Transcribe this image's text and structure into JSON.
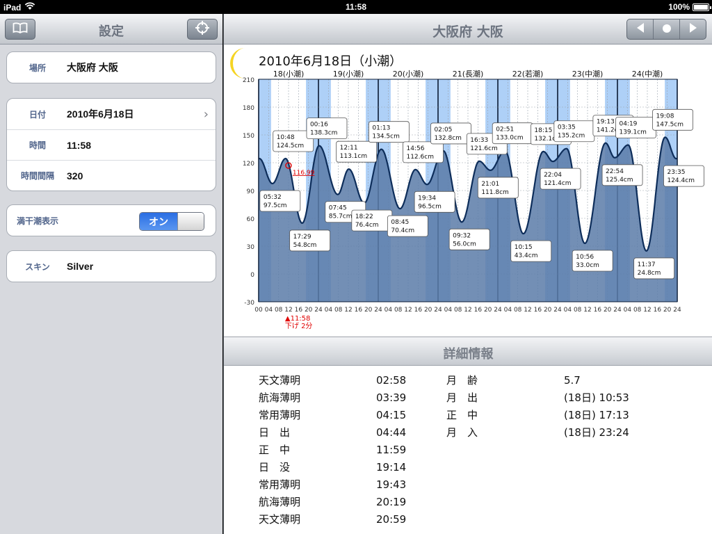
{
  "status": {
    "device": "iPad",
    "time": "11:58",
    "battery": "100%",
    "battery_level": 1.0
  },
  "left": {
    "title": "設定",
    "groups": {
      "place": {
        "label": "場所",
        "value": "大阪府 大阪"
      },
      "date": {
        "label": "日付",
        "value": "2010年6月18日"
      },
      "time": {
        "label": "時間",
        "value": "11:58"
      },
      "interval": {
        "label": "時間間隔",
        "value": "320"
      },
      "tidal": {
        "label": "満干潮表示",
        "toggle": "オン",
        "toggle_on": true
      },
      "skin": {
        "label": "スキン",
        "value": "Silver"
      }
    }
  },
  "right": {
    "title": "大阪府 大阪",
    "detail_title": "詳細情報"
  },
  "colors": {
    "line": "#0d2d5a",
    "fill": "#5a7ba8",
    "day_band": "#aed0f7",
    "night_band": "#ffffff",
    "current": "#e00000"
  },
  "chart_data": {
    "type": "area",
    "title": "2010年6月18日（小潮）",
    "ylim": [
      -30,
      210
    ],
    "yticks": [
      210,
      180,
      150,
      120,
      90,
      60,
      30,
      0,
      -30
    ],
    "days": [
      "18(小潮)",
      "19(小潮)",
      "20(小潮)",
      "21(長潮)",
      "22(若潮)",
      "23(中潮)",
      "24(中潮)"
    ],
    "hour_ticks": [
      "00",
      "04",
      "08",
      "12",
      "16",
      "20",
      "24",
      "04",
      "08",
      "12",
      "16",
      "20",
      "24",
      "04",
      "08",
      "12",
      "16",
      "20",
      "24",
      "04",
      "08",
      "12",
      "16",
      "20",
      "24",
      "04",
      "08",
      "12",
      "16",
      "20",
      "24",
      "04",
      "08",
      "12",
      "16",
      "20",
      "24",
      "04",
      "08",
      "12",
      "16",
      "20",
      "24"
    ],
    "extremes": [
      {
        "h": 5.53,
        "v": 97.5,
        "t": "05:32",
        "lbl": "97.5cm"
      },
      {
        "h": 10.8,
        "v": 124.5,
        "t": "10:48",
        "lbl": "124.5cm"
      },
      {
        "h": 17.48,
        "v": 54.8,
        "t": "17:29",
        "lbl": "54.8cm"
      },
      {
        "h": 24.27,
        "v": 138.3,
        "t": "00:16",
        "lbl": "138.3cm"
      },
      {
        "h": 31.75,
        "v": 85.7,
        "t": "07:45",
        "lbl": "85.7cm"
      },
      {
        "h": 36.18,
        "v": 113.1,
        "t": "12:11",
        "lbl": "113.1cm"
      },
      {
        "h": 42.37,
        "v": 76.4,
        "t": "18:22",
        "lbl": "76.4cm"
      },
      {
        "h": 49.22,
        "v": 134.5,
        "t": "01:13",
        "lbl": "134.5cm"
      },
      {
        "h": 56.75,
        "v": 70.4,
        "t": "08:45",
        "lbl": "70.4cm"
      },
      {
        "h": 62.93,
        "v": 112.6,
        "t": "14:56",
        "lbl": "112.6cm"
      },
      {
        "h": 67.57,
        "v": 96.5,
        "t": "19:34",
        "lbl": "96.5cm"
      },
      {
        "h": 74.08,
        "v": 132.8,
        "t": "02:05",
        "lbl": "132.8cm"
      },
      {
        "h": 81.53,
        "v": 56.0,
        "t": "09:32",
        "lbl": "56.0cm"
      },
      {
        "h": 88.55,
        "v": 121.6,
        "t": "16:33",
        "lbl": "121.6cm"
      },
      {
        "h": 93.02,
        "v": 111.8,
        "t": "21:01",
        "lbl": "111.8cm"
      },
      {
        "h": 98.85,
        "v": 133.0,
        "t": "02:51",
        "lbl": "133.0cm"
      },
      {
        "h": 106.25,
        "v": 43.4,
        "t": "10:15",
        "lbl": "43.4cm"
      },
      {
        "h": 114.25,
        "v": 132.1,
        "t": "18:15",
        "lbl": "132.1cm"
      },
      {
        "h": 118.07,
        "v": 121.4,
        "t": "22:04",
        "lbl": "121.4cm"
      },
      {
        "h": 123.58,
        "v": 135.2,
        "t": "03:35",
        "lbl": "135.2cm"
      },
      {
        "h": 130.93,
        "v": 33.0,
        "t": "10:56",
        "lbl": "33.0cm"
      },
      {
        "h": 139.22,
        "v": 141.2,
        "t": "19:13",
        "lbl": "141.2cm"
      },
      {
        "h": 142.9,
        "v": 125.4,
        "t": "22:54",
        "lbl": "125.4cm"
      },
      {
        "h": 148.32,
        "v": 139.1,
        "t": "04:19",
        "lbl": "139.1cm"
      },
      {
        "h": 155.62,
        "v": 24.8,
        "t": "11:37",
        "lbl": "24.8cm"
      },
      {
        "h": 163.13,
        "v": 147.5,
        "t": "19:08",
        "lbl": "147.5cm"
      },
      {
        "h": 167.58,
        "v": 124.4,
        "t": "23:35",
        "lbl": "124.4cm"
      }
    ],
    "start_value": 145,
    "current": {
      "h": 11.97,
      "v": 116.99,
      "label": "116.99",
      "time": "▲11:58",
      "note": "下げ 2分"
    }
  },
  "detail": {
    "left_labels": [
      "天文薄明",
      "航海薄明",
      "常用薄明",
      "日　出",
      "正　中",
      "日　没",
      "常用薄明",
      "航海薄明",
      "天文薄明"
    ],
    "left_values": [
      "02:58",
      "03:39",
      "04:15",
      "04:44",
      "11:59",
      "19:14",
      "19:43",
      "20:19",
      "20:59"
    ],
    "right_labels": [
      "月　齢",
      "月　出",
      "正　中",
      "月　入"
    ],
    "right_values": [
      "5.7",
      "(18日) 10:53",
      "(18日) 17:13",
      "(18日) 23:24"
    ]
  }
}
